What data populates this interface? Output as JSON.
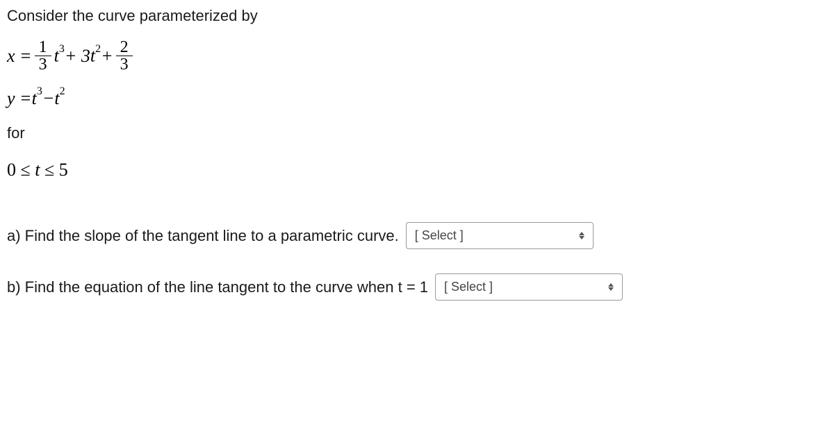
{
  "intro": "Consider the curve parameterized by",
  "equations": {
    "x_lhs": "x = ",
    "x_frac1_num": "1",
    "x_frac1_den": "3",
    "x_term1_var": "t",
    "x_term1_exp": "3",
    "x_plus1": " + 3",
    "x_term2_var": "t",
    "x_term2_exp": "2",
    "x_plus2": " + ",
    "x_frac2_num": "2",
    "x_frac2_den": "3",
    "y_lhs": "y = ",
    "y_term1_var": "t",
    "y_term1_exp": "3",
    "y_minus": " − ",
    "y_term2_var": "t",
    "y_term2_exp": "2"
  },
  "for": "for",
  "range": {
    "zero": "0 ",
    "le1": "≤ ",
    "t": "t",
    "le2": " ≤ ",
    "five": "5"
  },
  "question_a": "a) Find the slope of the tangent line to a parametric curve.",
  "question_b": "b) Find the equation of the line tangent to the curve when t = 1",
  "select_placeholder": "[ Select ]"
}
